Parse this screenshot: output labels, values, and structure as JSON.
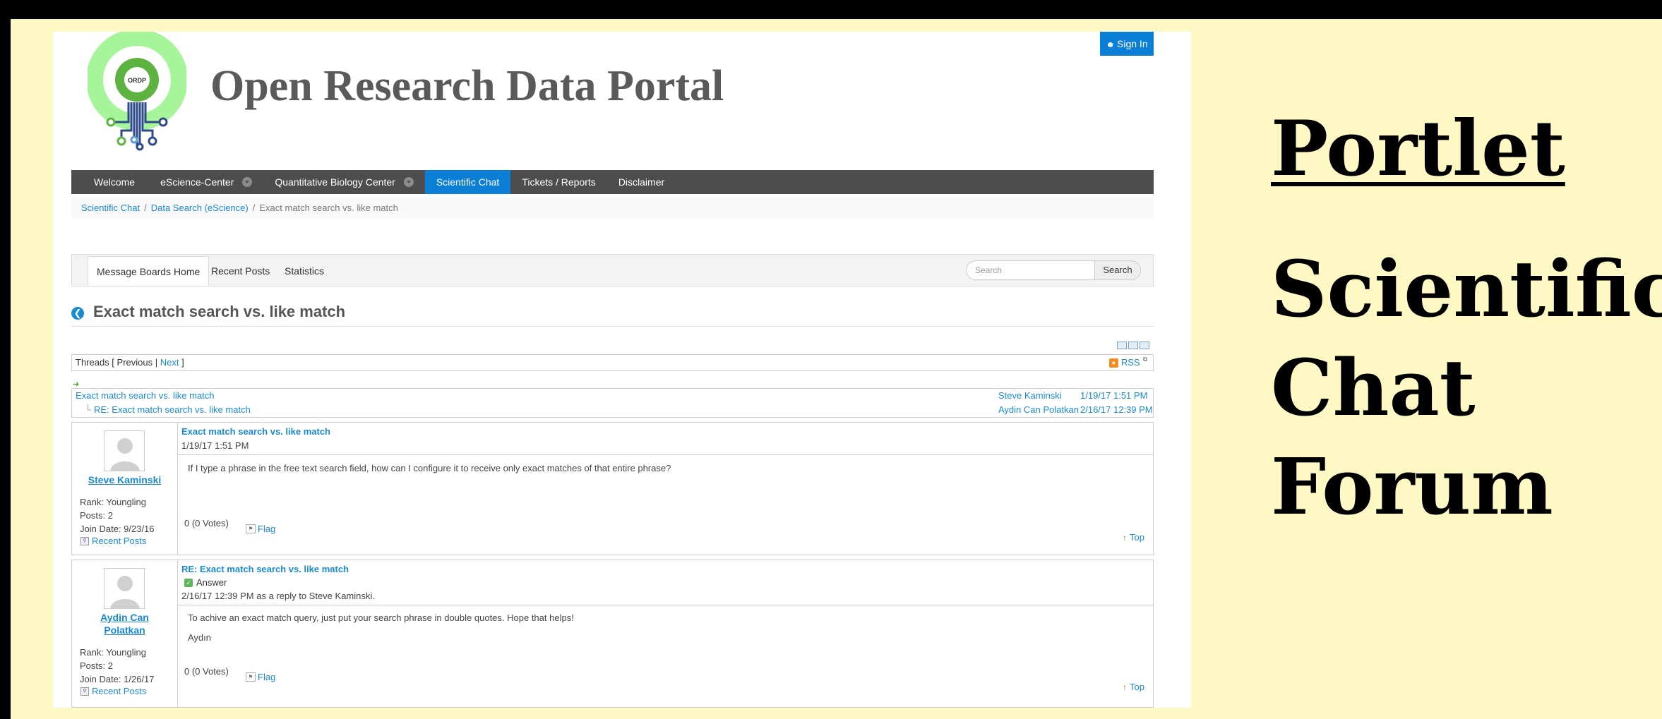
{
  "site": {
    "title": "Open Research Data Portal",
    "logo_text": "ORDP",
    "sign_in": "Sign In"
  },
  "nav": [
    {
      "label": "Welcome",
      "dropdown": false,
      "active": false
    },
    {
      "label": "eScience-Center",
      "dropdown": true,
      "active": false
    },
    {
      "label": "Quantitative Biology Center",
      "dropdown": true,
      "active": false
    },
    {
      "label": "Scientific Chat",
      "dropdown": false,
      "active": true
    },
    {
      "label": "Tickets / Reports",
      "dropdown": false,
      "active": false
    },
    {
      "label": "Disclaimer",
      "dropdown": false,
      "active": false
    }
  ],
  "breadcrumb": [
    "Scientific Chat",
    "Data Search (eScience)",
    "Exact match search vs. like match"
  ],
  "board_tabs": [
    "Message Boards Home",
    "Recent Posts",
    "Statistics"
  ],
  "search": {
    "placeholder": "Search",
    "button": "Search"
  },
  "thread": {
    "title": "Exact match search vs. like match",
    "nav_prefix": "Threads [",
    "previous": "Previous",
    "separator": "|",
    "next": "Next",
    "nav_suffix": "]",
    "rss": "RSS"
  },
  "tree": [
    {
      "subject": "Exact match search vs. like match",
      "author": "Steve Kaminski",
      "date": "1/19/17 1:51 PM"
    },
    {
      "subject": "RE: Exact match search vs. like match",
      "author": "Aydin Can Polatkan",
      "date": "2/16/17 12:39 PM"
    }
  ],
  "posts": [
    {
      "author": "Steve Kaminski",
      "rank": "Rank: Youngling",
      "posts": "Posts: 2",
      "join": "Join Date: 9/23/16",
      "recent": "Recent Posts",
      "subject": "Exact match search vs. like match",
      "answer": "",
      "date": "1/19/17 1:51 PM",
      "body": "If I type a phrase in the free text search field, how can I configure it to receive only exact matches of that entire phrase?",
      "body2": "",
      "votes": "0 (0 Votes)",
      "flag": "Flag",
      "top": "Top"
    },
    {
      "author": "Aydin Can Polatkan",
      "rank": "Rank: Youngling",
      "posts": "Posts: 2",
      "join": "Join Date: 1/26/17",
      "recent": "Recent Posts",
      "subject": "RE: Exact match search vs. like match",
      "answer": "Answer",
      "date": "2/16/17 12:39 PM as a reply to Steve Kaminski.",
      "body": "To achive an exact match query, just put your search phrase in double quotes. Hope that helps!",
      "body2": "Aydın",
      "votes": "0 (0 Votes)",
      "flag": "Flag",
      "top": "Top"
    }
  ],
  "side_panel": {
    "heading": "Portlet",
    "lines": [
      "Scientific",
      "Chat",
      "Forum"
    ]
  },
  "colors": {
    "accent": "#0b7ed6",
    "link": "#1a8ad4",
    "nav_bg": "#4d4d4d",
    "background": "#fef8c5",
    "logo_green": "#5cb340",
    "logo_light_green": "#a6f59a"
  }
}
